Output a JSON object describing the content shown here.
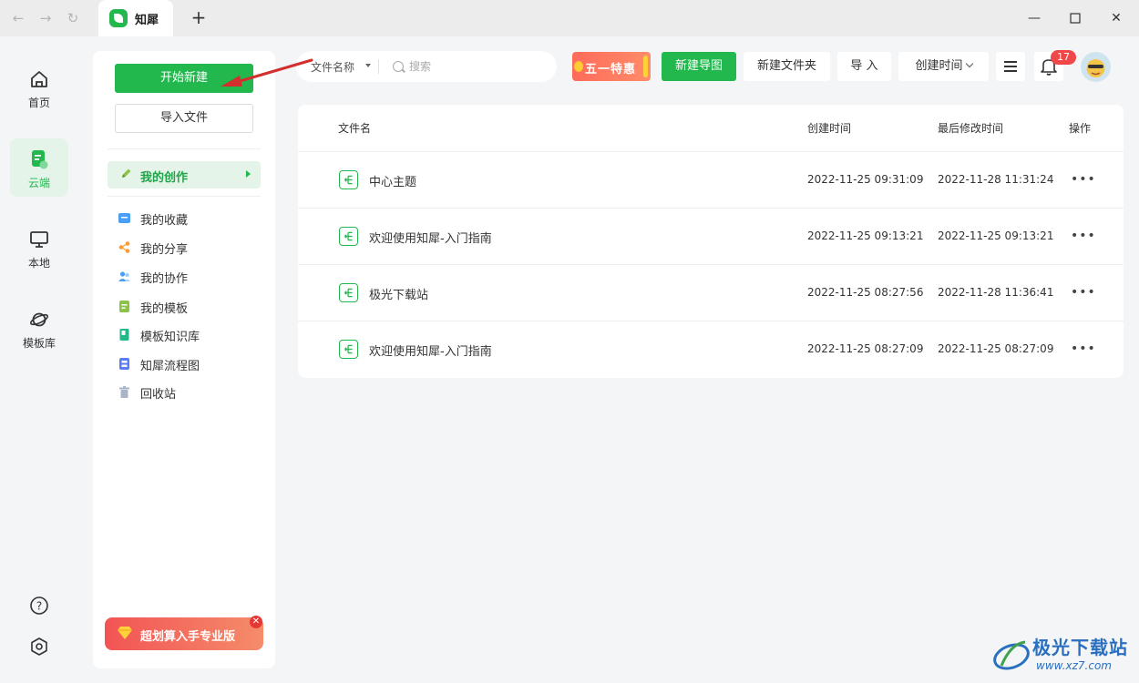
{
  "browser": {
    "tab_title": "知犀",
    "new_tab_label": "+"
  },
  "rail": {
    "items": [
      {
        "label": "首页",
        "icon": "home-icon",
        "active": false
      },
      {
        "label": "云端",
        "icon": "cloud-doc-icon",
        "active": true
      },
      {
        "label": "本地",
        "icon": "monitor-icon",
        "active": false
      },
      {
        "label": "模板库",
        "icon": "planet-icon",
        "active": false
      }
    ]
  },
  "side": {
    "new_button": "开始新建",
    "import_button": "导入文件",
    "active_item": "我的创作",
    "items": [
      {
        "label": "我的收藏",
        "icon": "folder-star-icon",
        "color": "#4a9ff5"
      },
      {
        "label": "我的分享",
        "icon": "share-icon",
        "color": "#ff9a2e"
      },
      {
        "label": "我的协作",
        "icon": "users-icon",
        "color": "#4a9ff5"
      },
      {
        "label": "我的模板",
        "icon": "template-icon",
        "color": "#8bc34a"
      },
      {
        "label": "模板知识库",
        "icon": "book-icon",
        "color": "#22b889"
      },
      {
        "label": "知犀流程图",
        "icon": "flowchart-icon",
        "color": "#5b7cf5"
      },
      {
        "label": "回收站",
        "icon": "trash-icon",
        "color": "#a9b4c8"
      }
    ],
    "promo": "超划算入手专业版"
  },
  "toolbar": {
    "filter_label": "文件名称",
    "search_placeholder": "搜索",
    "promo_label": "五一特惠",
    "new_mindmap": "新建导图",
    "new_folder": "新建文件夹",
    "import": "导 入",
    "sort": "创建时间",
    "notification_count": "17"
  },
  "table": {
    "columns": [
      "文件名",
      "创建时间",
      "最后修改时间",
      "操作"
    ],
    "rows": [
      {
        "name": "中心主题",
        "created": "2022-11-25 09:31:09",
        "modified": "2022-11-28 11:31:24"
      },
      {
        "name": "欢迎使用知犀-入门指南",
        "created": "2022-11-25 09:13:21",
        "modified": "2022-11-25 09:13:21"
      },
      {
        "name": "极光下载站",
        "created": "2022-11-25 08:27:56",
        "modified": "2022-11-28 11:36:41"
      },
      {
        "name": "欢迎使用知犀-入门指南",
        "created": "2022-11-25 08:27:09",
        "modified": "2022-11-25 08:27:09"
      }
    ]
  },
  "watermark": {
    "text": "极光下载站",
    "url": "www.xz7.com"
  },
  "colors": {
    "brand_green": "#22b84e",
    "active_bg": "#e4f4e8",
    "badge_red": "#f04848",
    "annotation_arrow": "#d32f2f"
  }
}
